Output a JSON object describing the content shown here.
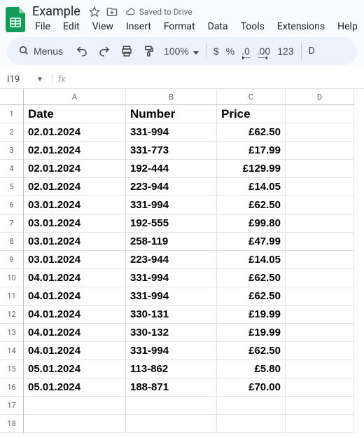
{
  "doc": {
    "title": "Example",
    "drive_status": "Saved to Drive"
  },
  "menu": {
    "file": "File",
    "edit": "Edit",
    "view": "View",
    "insert": "Insert",
    "format": "Format",
    "data": "Data",
    "tools": "Tools",
    "extensions": "Extensions",
    "help": "Help"
  },
  "toolbar": {
    "search_label": "Menus",
    "zoom": "100%",
    "currency": "$",
    "percent": "%",
    "dec_dec": ".0",
    "inc_dec": ".00",
    "numfmt": "123",
    "trailing": "D"
  },
  "namebox": {
    "ref": "I19"
  },
  "columns": [
    "A",
    "B",
    "C",
    "D"
  ],
  "headers": {
    "date": "Date",
    "number": "Number",
    "price": "Price"
  },
  "rows": [
    {
      "n": "1"
    },
    {
      "n": "2",
      "date": "02.01.2024",
      "number": "331-994",
      "price": "£62.50"
    },
    {
      "n": "3",
      "date": "02.01.2024",
      "number": "331-773",
      "price": "£17.99"
    },
    {
      "n": "4",
      "date": "02.01.2024",
      "number": "192-444",
      "price": "£129.99"
    },
    {
      "n": "5",
      "date": "02.01.2024",
      "number": "223-944",
      "price": "£14.05"
    },
    {
      "n": "6",
      "date": "03.01.2024",
      "number": "331-994",
      "price": "£62.50"
    },
    {
      "n": "7",
      "date": "03.01.2024",
      "number": "192-555",
      "price": "£99.80"
    },
    {
      "n": "8",
      "date": "03.01.2024",
      "number": "258-119",
      "price": "£47.99"
    },
    {
      "n": "9",
      "date": "03.01.2024",
      "number": "223-944",
      "price": "£14.05"
    },
    {
      "n": "10",
      "date": "04.01.2024",
      "number": "331-994",
      "price": "£62.50"
    },
    {
      "n": "11",
      "date": "04.01.2024",
      "number": "331-994",
      "price": "£62.50"
    },
    {
      "n": "12",
      "date": "04.01.2024",
      "number": "330-131",
      "price": "£19.99"
    },
    {
      "n": "13",
      "date": "04.01.2024",
      "number": "330-132",
      "price": "£19.99"
    },
    {
      "n": "14",
      "date": "04.01.2024",
      "number": "331-994",
      "price": "£62.50"
    },
    {
      "n": "15",
      "date": "05.01.2024",
      "number": "113-862",
      "price": "£5.80"
    },
    {
      "n": "16",
      "date": "05.01.2024",
      "number": "188-871",
      "price": "£70.00"
    },
    {
      "n": "17"
    },
    {
      "n": "18"
    }
  ]
}
